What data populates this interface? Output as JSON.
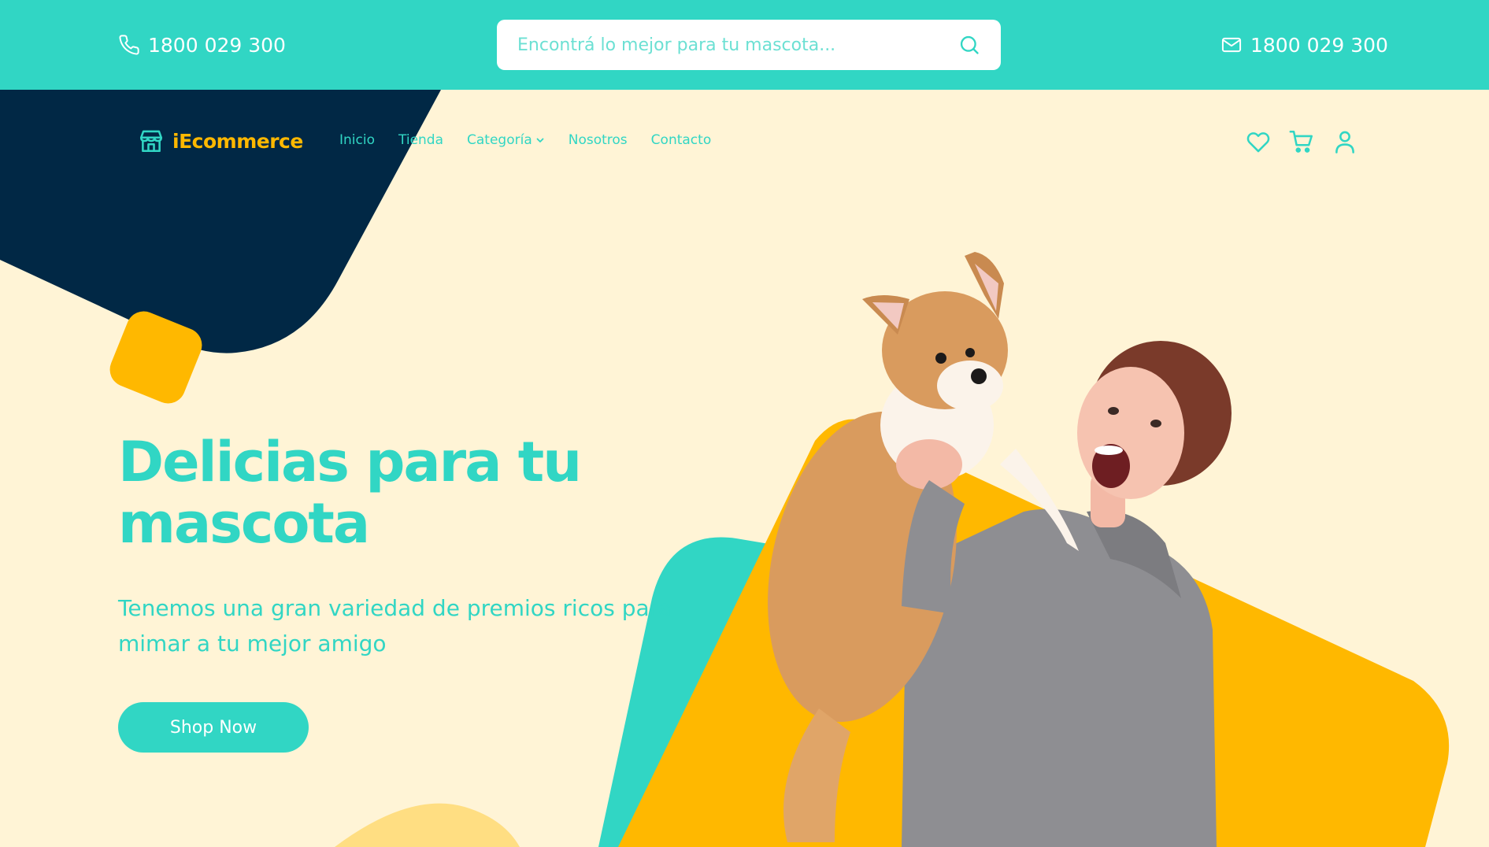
{
  "colors": {
    "teal": "#31D6C4",
    "navy": "#012845",
    "yellow": "#FFB800",
    "cream": "#FFF4D6",
    "white": "#FFFFFF"
  },
  "topbar": {
    "phone": {
      "icon": "phone-icon",
      "text": "1800 029 300"
    },
    "search": {
      "placeholder": "Encontrá lo mejor para tu mascota...",
      "value": "",
      "icon": "search-icon"
    },
    "email": {
      "icon": "mail-icon",
      "text": "1800 029 300"
    }
  },
  "navbar": {
    "logo": {
      "icon": "storefront-icon",
      "text": "iEcommerce"
    },
    "items": [
      {
        "label": "Inicio"
      },
      {
        "label": "Tienda"
      },
      {
        "label": "Categoría",
        "icon": "chevron-down-icon"
      },
      {
        "label": "Nosotros"
      },
      {
        "label": "Contacto"
      }
    ],
    "icons": [
      "heart-icon",
      "cart-icon",
      "user-icon"
    ]
  },
  "hero": {
    "title": "Delicias para tu mascota",
    "subtitle": "Tenemos una gran variedad de premios ricos para mimar a tu mejor amigo",
    "cta": "Shop Now",
    "image": "woman holding a corgi dog"
  }
}
